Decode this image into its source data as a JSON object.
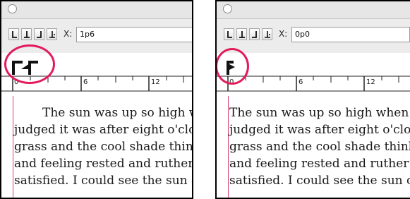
{
  "panels": [
    {
      "id": "left",
      "x_label": "X:",
      "x_value": "1p6",
      "ruler_labels": [
        "0",
        "6",
        "12"
      ],
      "lines": [
        "The sun was up so high w",
        "judged it was after eight o'clock",
        "grass and the cool shade think",
        "and feeling rested and ruther c",
        "satisfied. I could see the sun o"
      ]
    },
    {
      "id": "right",
      "x_label": "X:",
      "x_value": "0p0",
      "ruler_labels": [
        "0",
        "6",
        "12"
      ],
      "lines": [
        "The sun was up so high when",
        "judged it was after eight o'clock",
        "grass and the cool shade think",
        "and feeling rested and ruther c",
        "satisfied. I could see the sun ou"
      ]
    }
  ],
  "tab_icons": [
    "left-tab-icon",
    "center-tab-icon",
    "right-tab-icon",
    "align-decimal-tab-icon"
  ],
  "colors": {
    "highlight": "#e21b5b",
    "margin_guide": "#d6407a"
  }
}
